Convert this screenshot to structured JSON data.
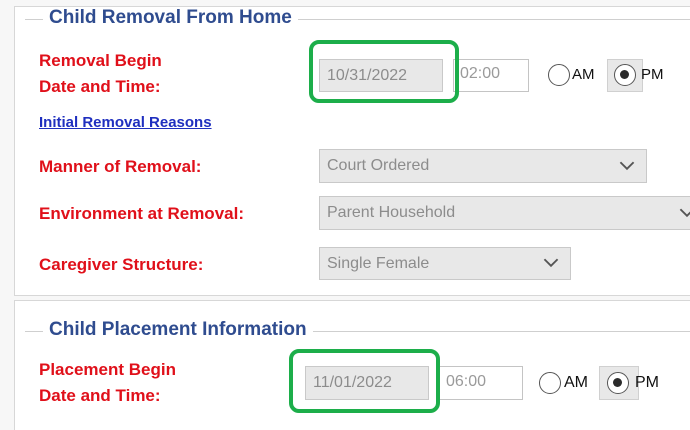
{
  "removal": {
    "legend": "Child Removal From Home",
    "begin_label_line1": "Removal Begin",
    "begin_label_line2": "Date and Time:",
    "date": "10/31/2022",
    "time": "02:00",
    "am": "AM",
    "pm": "PM",
    "initial_reasons_link": "Initial Removal Reasons",
    "manner_label": "Manner of Removal:",
    "manner_value": "Court Ordered",
    "environment_label": "Environment at Removal:",
    "environment_value": "Parent Household",
    "caregiver_label": "Caregiver Structure:",
    "caregiver_value": "Single Female"
  },
  "placement": {
    "legend": "Child Placement Information",
    "begin_label_line1": "Placement Begin",
    "begin_label_line2": "Date and Time:",
    "date": "11/01/2022",
    "time": "06:00",
    "am": "AM",
    "pm": "PM"
  },
  "colors": {
    "legend": "#2f4c8f",
    "required_label": "#e0101a",
    "link": "#1f2fbf",
    "highlight": "#1cae4a"
  }
}
